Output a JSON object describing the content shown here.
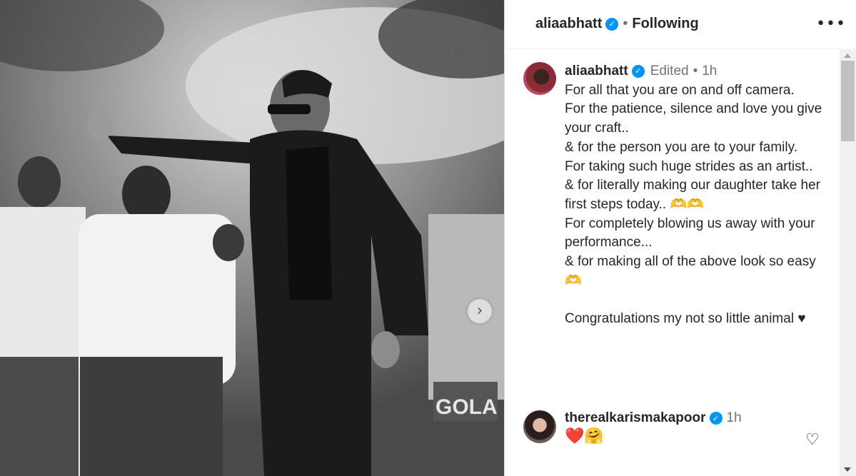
{
  "post": {
    "username": "aliaabhatt",
    "verified_icon": "verified-badge-icon",
    "separator": "•",
    "following_label": "Following",
    "more_label": "•••"
  },
  "caption": {
    "username": "aliaabhatt",
    "edited_label": "Edited",
    "separator": "•",
    "time": "1h",
    "text": "For all that you are on and off camera.\nFor the patience, silence and love you give your craft..\n& for the person you are to your family.\nFor taking such huge strides as an artist..\n& for literally making our daughter take her first steps today.. 🫶🫶\nFor completely blowing us away with your performance...\n& for making all of the above look so easy 🫶\n\nCongratulations my not so little animal ♥"
  },
  "comment": {
    "username": "therealkarismakapoor",
    "time": "1h",
    "text": "❤️🤗"
  },
  "carousel": {
    "next_label": "›"
  },
  "colors": {
    "verified": "#0095f6",
    "secondary_text": "#737373"
  }
}
